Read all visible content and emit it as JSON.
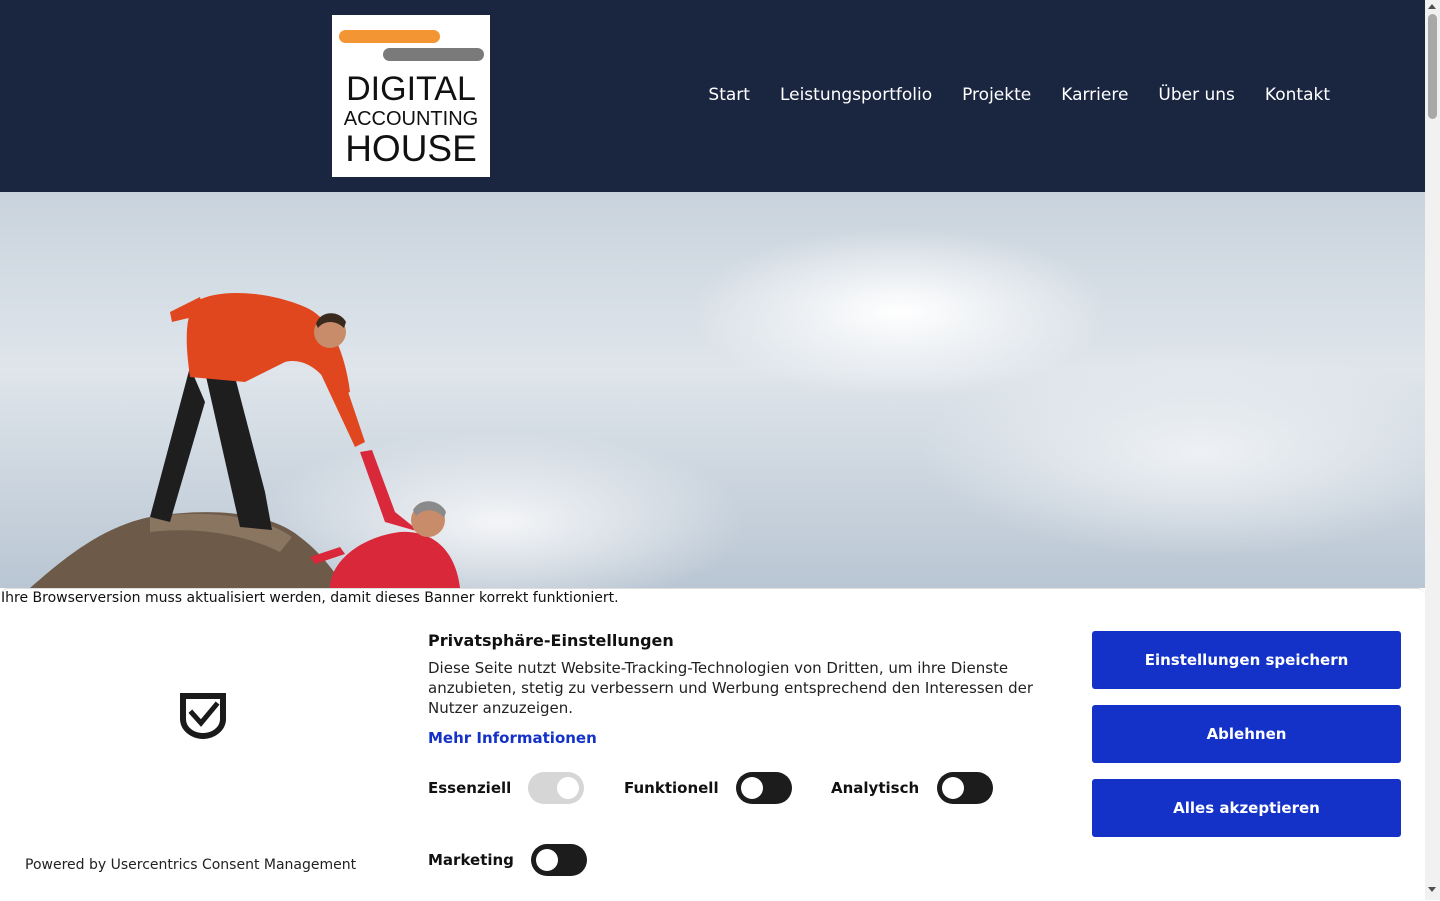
{
  "logo": {
    "line1": "DIGITAL",
    "line2": "ACCOUNTING",
    "line3": "HOUSE"
  },
  "nav": [
    "Start",
    "Leistungsportfolio",
    "Projekte",
    "Karriere",
    "Über uns",
    "Kontakt"
  ],
  "banner": {
    "warning": "Ihre Browserversion muss aktualisiert werden, damit dieses Banner korrekt funktioniert.",
    "title": "Privatsphäre-Einstellungen",
    "description": "Diese Seite nutzt Website-Tracking-Technologien von Dritten, um ihre Dienste anzubieten, stetig zu verbessern und Werbung entsprechend den Interessen der Nutzer anzuzeigen.",
    "more_info": "Mehr Informationen",
    "powered_by": "Powered by Usercentrics Consent Management",
    "toggles": [
      {
        "label": "Essenziell",
        "state": "on-disabled"
      },
      {
        "label": "Funktionell",
        "state": "off"
      },
      {
        "label": "Analytisch",
        "state": "off"
      },
      {
        "label": "Marketing",
        "state": "off"
      }
    ],
    "buttons": {
      "save": "Einstellungen speichern",
      "decline": "Ablehnen",
      "accept": "Alles akzeptieren"
    }
  },
  "colors": {
    "header_bg": "#1a2540",
    "accent": "#1432c8",
    "logo_orange": "#f39533",
    "logo_gray": "#7a7a7a"
  },
  "icons": {
    "consent": "shield-check-icon"
  }
}
